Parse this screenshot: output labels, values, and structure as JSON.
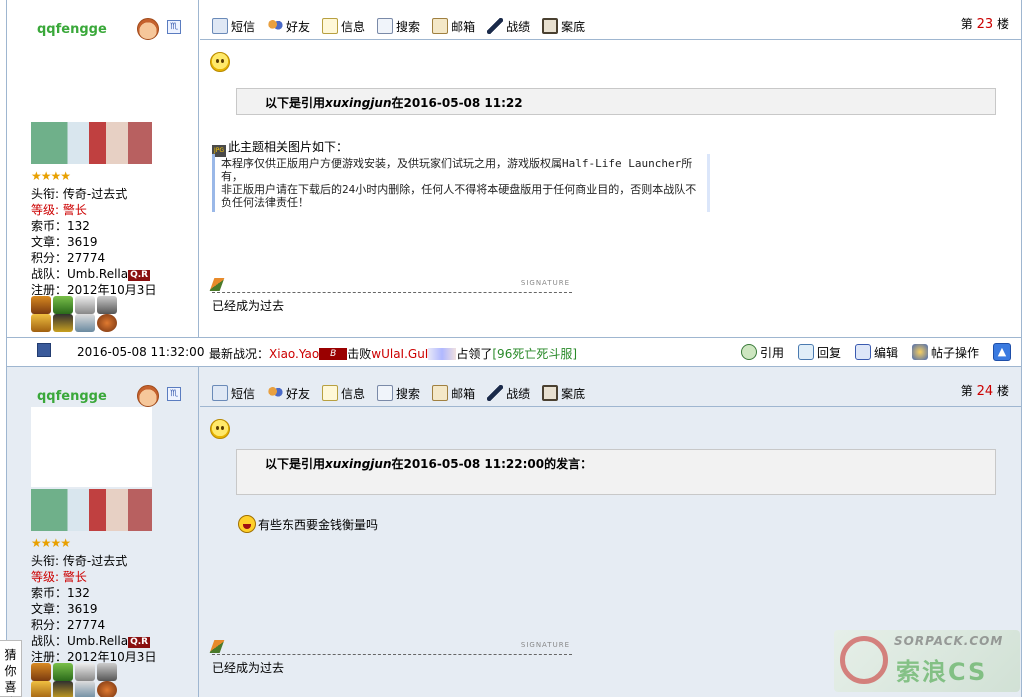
{
  "posts": [
    {
      "username": "qqfengge",
      "sex_icon": "♏",
      "stars": "★★★★",
      "title_label": "头衔:",
      "title_value": "传奇-过去式",
      "level_label": "等级:",
      "level_value": "警长",
      "coins": "索币：132",
      "articles": "文章：3619",
      "points": "积分：27774",
      "team_label": "战队：Umb.Rella",
      "team_badge": "Q.R",
      "register": "注册：2012年10月3日",
      "floor_prefix": "第",
      "floor_num": "23",
      "floor_suffix": "楼",
      "quote_prefix": "以下是引用",
      "quote_user": "xuxingjun",
      "quote_suffix": "在2016-05-08 11:22",
      "pic_title": "此主题相关图片如下：",
      "pic_line1": "本程序仅供正版用户方便游戏安装，及供玩家们试玩之用，游戏版权属Half-Life Launcher所有，",
      "pic_line2": "非正版用户请在下载后的24小时内删除，任何人不得将本硬盘版用于任何商业目的，否则本战队不负任何法律责任！",
      "sig_tag": "SIGNATURE",
      "signature": "已经成为过去"
    },
    {
      "username": "qqfengge",
      "sex_icon": "♏",
      "stars": "★★★★",
      "title_label": "头衔:",
      "title_value": "传奇-过去式",
      "level_label": "等级:",
      "level_value": "警长",
      "coins": "索币：132",
      "articles": "文章：3619",
      "points": "积分：27774",
      "team_label": "战队：Umb.Rella",
      "team_badge": "Q.R",
      "register": "注册：2012年10月3日",
      "floor_prefix": "第",
      "floor_num": "24",
      "floor_suffix": "楼",
      "quote_prefix": "以下是引用",
      "quote_user": "xuxingjun",
      "quote_suffix": "在2016-05-08 11:22:00的发言：",
      "reply": "有些东西要金钱衡量吗",
      "sig_tag": "SIGNATURE",
      "signature": "已经成为过去"
    }
  ],
  "toolbar": {
    "message": "短信",
    "friend": "好友",
    "info": "信息",
    "search": "搜索",
    "mail": "邮箱",
    "record": "战绩",
    "archive": "案底"
  },
  "bar": {
    "time": "2016-05-08 11:32:00",
    "news_prefix": "最新战况：",
    "player_a": "Xiao.Yao",
    "clan_a": "B",
    "defeat": "击败",
    "player_b": "wUlaI.GuI",
    "occupied": "占领了",
    "server": "[96死亡死斗服]",
    "quote": "引用",
    "reply": "回复",
    "edit": "编辑",
    "manage": "帖子操作",
    "top": "▲"
  },
  "guess": "猜你喜欢",
  "watermark": {
    "text": "SORPACK.COM",
    "cn": "索浪CS"
  }
}
